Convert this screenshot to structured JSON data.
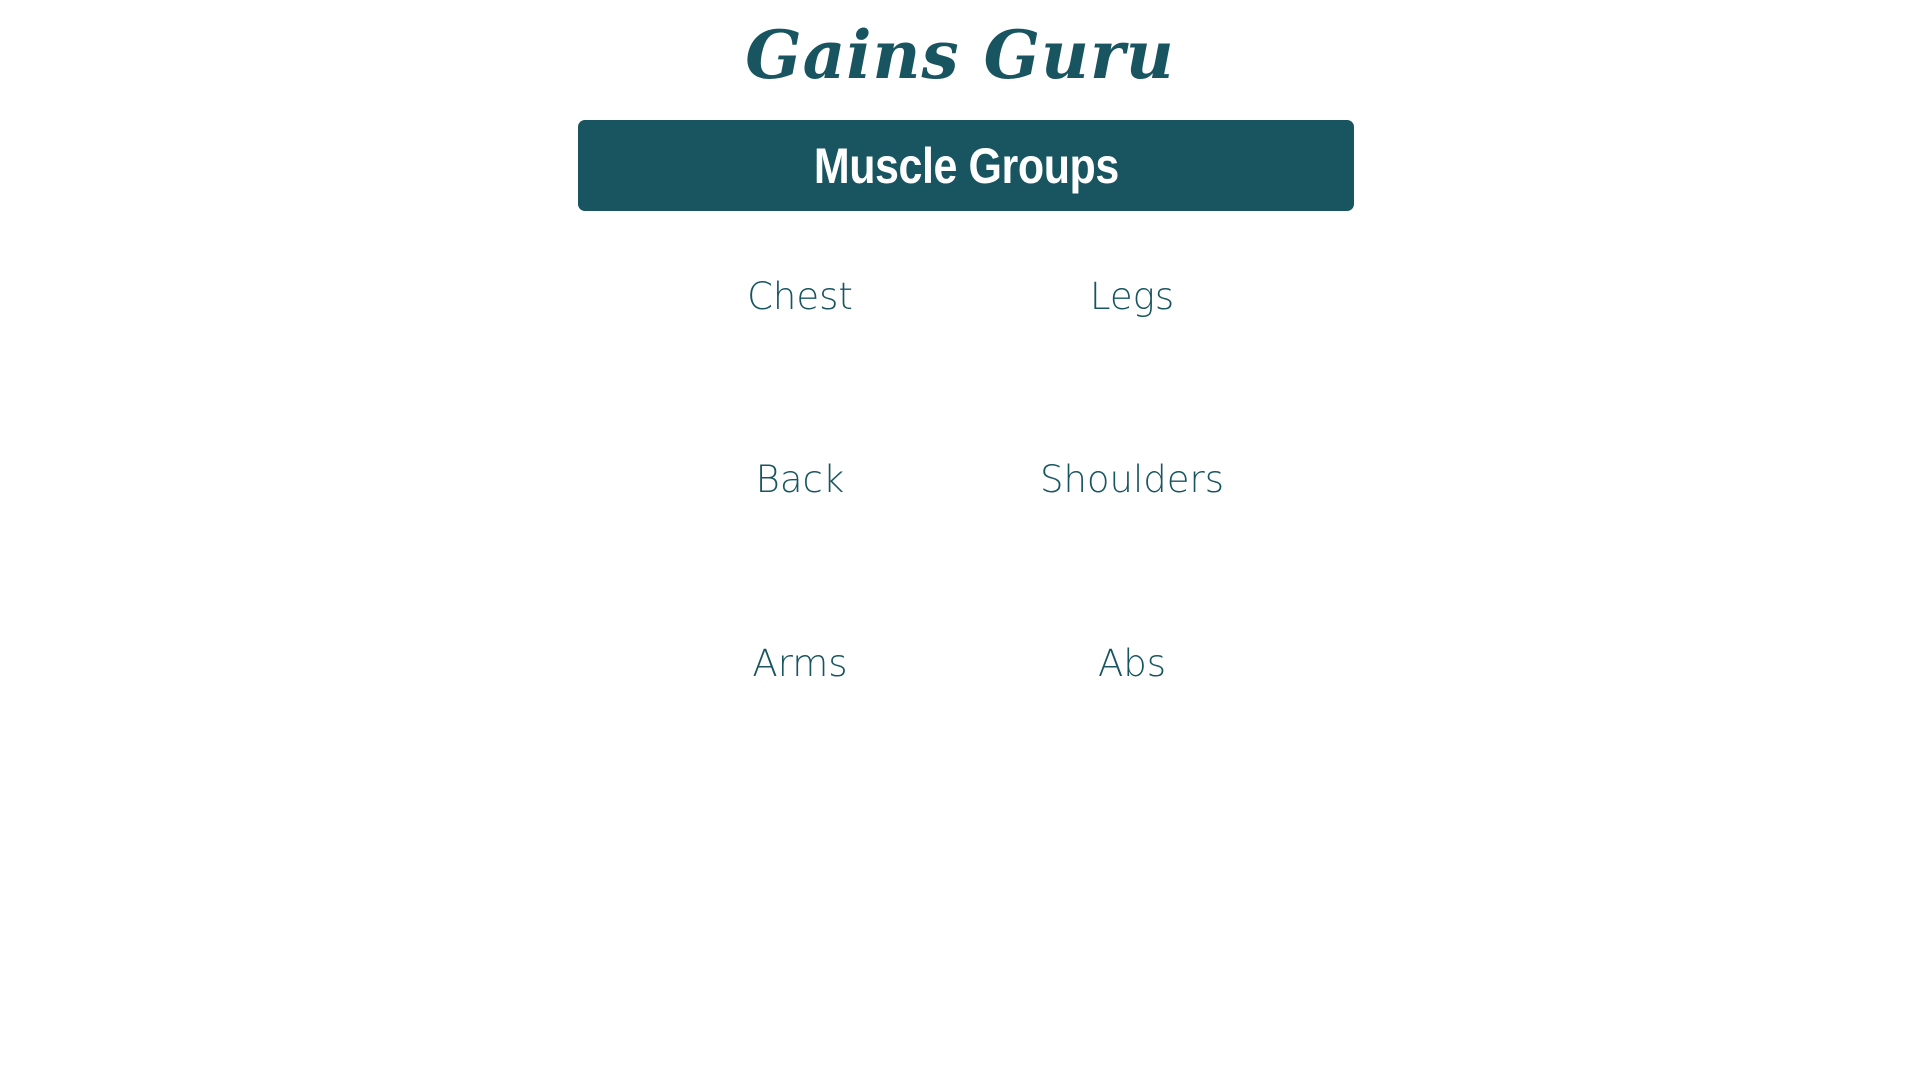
{
  "app": {
    "title": "Gains Guru"
  },
  "header": {
    "title": "Muscle Groups"
  },
  "muscle_groups": [
    {
      "label": "Chest"
    },
    {
      "label": "Legs"
    },
    {
      "label": "Back"
    },
    {
      "label": "Shoulders"
    },
    {
      "label": "Arms"
    },
    {
      "label": "Abs"
    }
  ],
  "colors": {
    "brand": "#185560",
    "background": "#ffffff",
    "header_text": "#ffffff"
  }
}
